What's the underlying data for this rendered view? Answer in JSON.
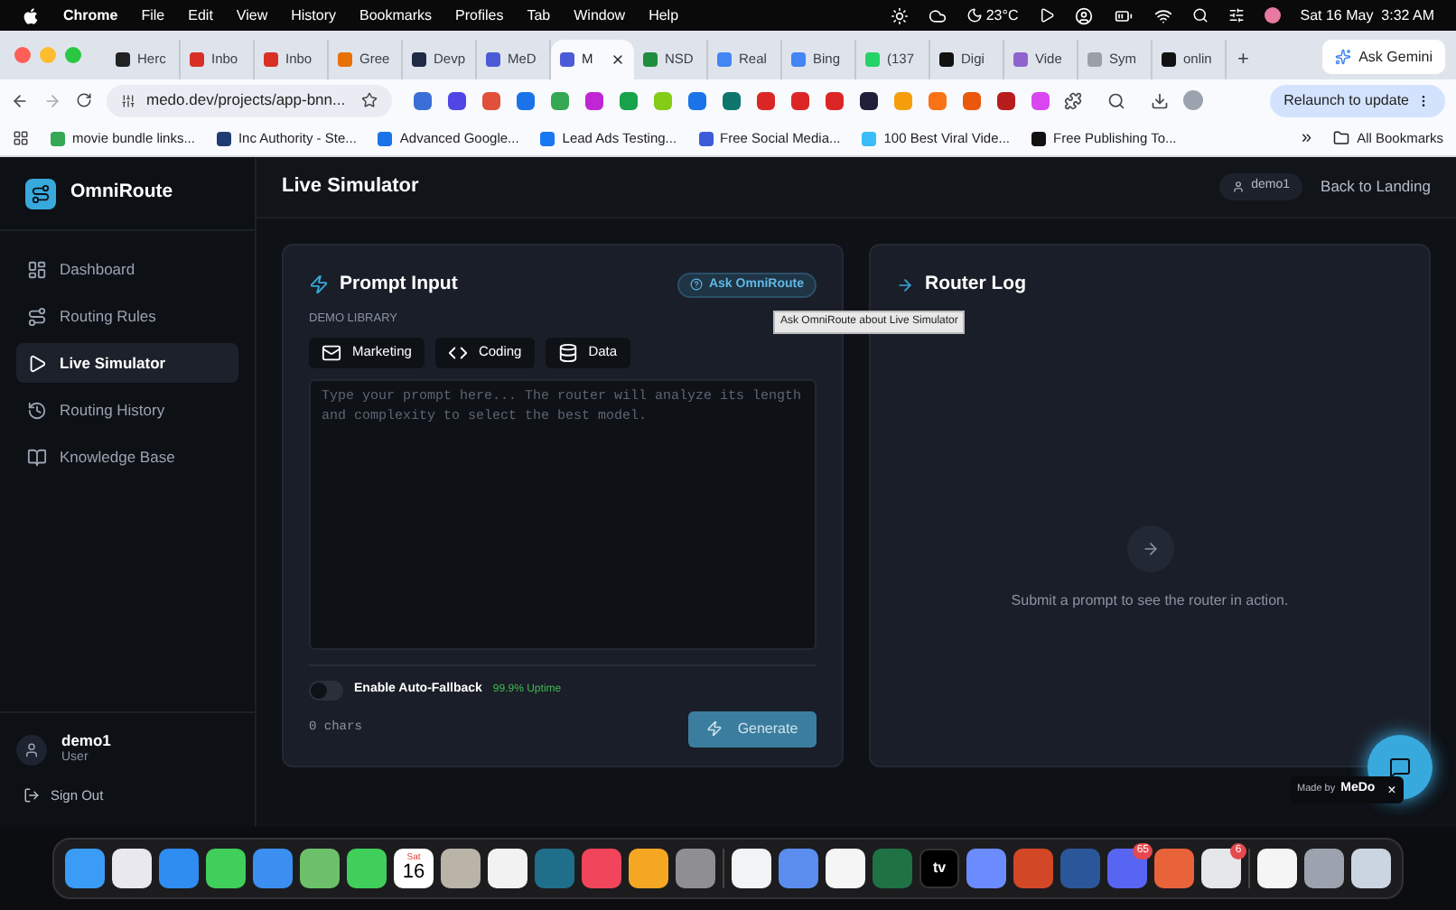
{
  "menu_bar": {
    "app": "Chrome",
    "menus": [
      "File",
      "Edit",
      "View",
      "History",
      "Bookmarks",
      "Profiles",
      "Tab",
      "Window",
      "Help"
    ],
    "temperature": "23°C",
    "clock": "Sat 16 May  3:32 AM"
  },
  "browser": {
    "tabs": [
      {
        "label": "Herc",
        "selected": false,
        "color": "#222222"
      },
      {
        "label": "Inbo",
        "selected": false,
        "color": "#d93025"
      },
      {
        "label": "Inbo",
        "selected": false,
        "color": "#d93025"
      },
      {
        "label": "Gree",
        "selected": false,
        "color": "#e8710a"
      },
      {
        "label": "Devp",
        "selected": false,
        "color": "#1f2a44"
      },
      {
        "label": "MeD",
        "selected": false,
        "color": "#4b5bd6"
      },
      {
        "label": "M",
        "selected": true,
        "color": "#4b5bd6"
      },
      {
        "label": "NSD",
        "selected": false,
        "color": "#1e8e3e"
      },
      {
        "label": "Real",
        "selected": false,
        "color": "#4285f4"
      },
      {
        "label": "Bing",
        "selected": false,
        "color": "#4285f4"
      },
      {
        "label": "(137",
        "selected": false,
        "color": "#25d366"
      },
      {
        "label": "Digi",
        "selected": false,
        "color": "#111111"
      },
      {
        "label": "Vide",
        "selected": false,
        "color": "#8e63ce"
      },
      {
        "label": "Sym",
        "selected": false,
        "color": "#9aa0a6"
      },
      {
        "label": "onlin",
        "selected": false,
        "color": "#111111"
      }
    ],
    "new_tab": "+",
    "ask_gemini": "Ask Gemini",
    "url": "medo.dev/projects/app-bnn...",
    "relaunch": "Relaunch to update",
    "extensions": [
      {
        "color": "#3b6fd8"
      },
      {
        "color": "#4f46e5"
      },
      {
        "color": "#e0503a"
      },
      {
        "color": "#1a73e8"
      },
      {
        "color": "#34a853"
      },
      {
        "color": "#c026d3"
      },
      {
        "color": "#16a34a"
      },
      {
        "color": "#84cc16"
      },
      {
        "color": "#1a73e8"
      },
      {
        "color": "#0f766e"
      },
      {
        "color": "#dc2626"
      },
      {
        "color": "#dc2626"
      },
      {
        "color": "#dc2626"
      },
      {
        "color": "#1f1f3a"
      },
      {
        "color": "#f59e0b"
      },
      {
        "color": "#f97316"
      },
      {
        "color": "#ea580c"
      },
      {
        "color": "#b91c1c"
      },
      {
        "color": "#d946ef"
      }
    ],
    "bookmarks": [
      {
        "label": "movie bundle links...",
        "color": "#34a853"
      },
      {
        "label": "Inc Authority - Ste...",
        "color": "#1f3b73"
      },
      {
        "label": "Advanced Google...",
        "color": "#1a73e8"
      },
      {
        "label": "Lead Ads Testing...",
        "color": "#1877f2"
      },
      {
        "label": "Free Social Media...",
        "color": "#3b5bdb"
      },
      {
        "label": "100 Best Viral Vide...",
        "color": "#38bdf8"
      },
      {
        "label": "Free Publishing To...",
        "color": "#111111"
      }
    ],
    "more_bookmarks": "»",
    "all_bookmarks": "All Bookmarks"
  },
  "app": {
    "brand": "OmniRoute",
    "nav": [
      {
        "label": "Dashboard",
        "selected": false,
        "kind": "dashboard"
      },
      {
        "label": "Routing Rules",
        "selected": false,
        "kind": "rules"
      },
      {
        "label": "Live Simulator",
        "selected": true,
        "kind": "simulator"
      },
      {
        "label": "Routing History",
        "selected": false,
        "kind": "history"
      },
      {
        "label": "Knowledge Base",
        "selected": false,
        "kind": "knowledge"
      }
    ],
    "user": {
      "name": "demo1",
      "role": "User"
    },
    "sign_out": "Sign Out",
    "page_title": "Live Simulator",
    "user_chip": "demo1",
    "back_link": "Back to Landing",
    "prompt_card": {
      "title": "Prompt Input",
      "ask_button": "Ask OmniRoute",
      "tooltip": "Ask OmniRoute about Live Simulator",
      "library_label": "DEMO LIBRARY",
      "demos": [
        {
          "label": "Marketing",
          "kind": "mail"
        },
        {
          "label": "Coding",
          "kind": "code"
        },
        {
          "label": "Data",
          "kind": "data"
        }
      ],
      "placeholder": "Type your prompt here... The router will analyze its length and complexity to select the best model.",
      "fallback": {
        "label": "Enable Auto-Fallback",
        "on": false,
        "uptime": "99.9% Uptime"
      },
      "char_count": "0 chars",
      "generate": "Generate"
    },
    "router_log": {
      "title": "Router Log",
      "empty_text": "Submit a prompt to see the router in action."
    },
    "made_by": {
      "label": "Made by",
      "brand": "MeDo",
      "close": "×"
    }
  },
  "dock": {
    "items": [
      {
        "kind": "app",
        "color": "#3b9cf5"
      },
      {
        "kind": "app",
        "color": "#e8e8ee"
      },
      {
        "kind": "app",
        "color": "#2f8cf0"
      },
      {
        "kind": "app",
        "color": "#3fcf5a"
      },
      {
        "kind": "app",
        "color": "#3a8ff0"
      },
      {
        "kind": "app",
        "color": "#6dc06a"
      },
      {
        "kind": "app",
        "color": "#3fcf5a"
      },
      {
        "kind": "calendar",
        "day": "Sat",
        "date": "16"
      },
      {
        "kind": "app",
        "color": "#b9b3a8"
      },
      {
        "kind": "app",
        "color": "#f2f2f2"
      },
      {
        "kind": "app",
        "color": "#1f6f8b"
      },
      {
        "kind": "app",
        "color": "#f0455a"
      },
      {
        "kind": "app",
        "color": "#f5a623"
      },
      {
        "kind": "app",
        "color": "#8e8e93"
      },
      {
        "kind": "divider"
      },
      {
        "kind": "app",
        "color": "#f1f3f4"
      },
      {
        "kind": "app",
        "color": "#5a8dee"
      },
      {
        "kind": "app",
        "color": "#f5f5f5"
      },
      {
        "kind": "app",
        "color": "#1f7244"
      },
      {
        "kind": "tv",
        "label": "tv"
      },
      {
        "kind": "app",
        "color": "#6b8cff"
      },
      {
        "kind": "app",
        "color": "#d24726"
      },
      {
        "kind": "app",
        "color": "#2b579a"
      },
      {
        "kind": "app",
        "color": "#5865f2",
        "badge": "65"
      },
      {
        "kind": "app",
        "color": "#e8623a"
      },
      {
        "kind": "app",
        "color": "#e5e7eb",
        "badge": "6"
      },
      {
        "kind": "divider"
      },
      {
        "kind": "app",
        "color": "#f5f5f5"
      },
      {
        "kind": "app",
        "color": "#9ca3af"
      },
      {
        "kind": "app",
        "color": "#cbd5e1"
      }
    ]
  }
}
